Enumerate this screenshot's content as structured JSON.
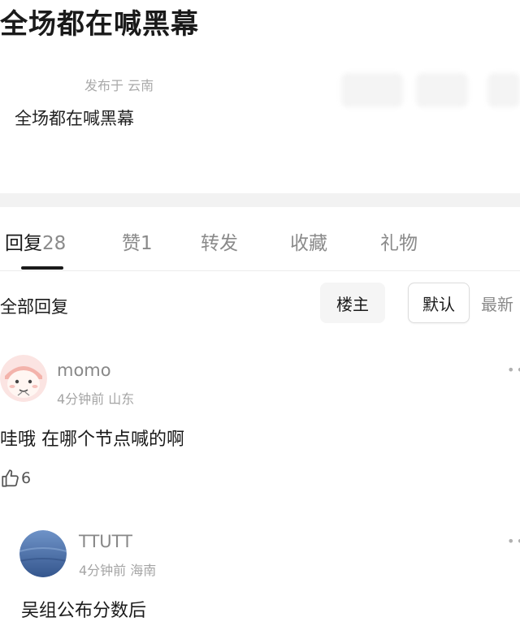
{
  "post": {
    "title": "全场都在喊黑幕",
    "meta": "发布于 云南",
    "body": "全场都在喊黑幕"
  },
  "tabs": [
    {
      "label": "回复",
      "count": "28"
    },
    {
      "label": "赞",
      "count": "1"
    },
    {
      "label": "转发"
    },
    {
      "label": "收藏"
    },
    {
      "label": "礼物"
    }
  ],
  "filter": {
    "label": "全部回复",
    "owner": "楼主",
    "default": "默认",
    "latest": "最新"
  },
  "comments": [
    {
      "username": "momo",
      "time": "4分钟前",
      "location": "山东",
      "text": "哇哦 在哪个节点喊的啊",
      "likes": "6"
    },
    {
      "username": "TTUTT",
      "time": "4分钟前",
      "location": "海南",
      "text": "吴组公布分数后"
    }
  ]
}
